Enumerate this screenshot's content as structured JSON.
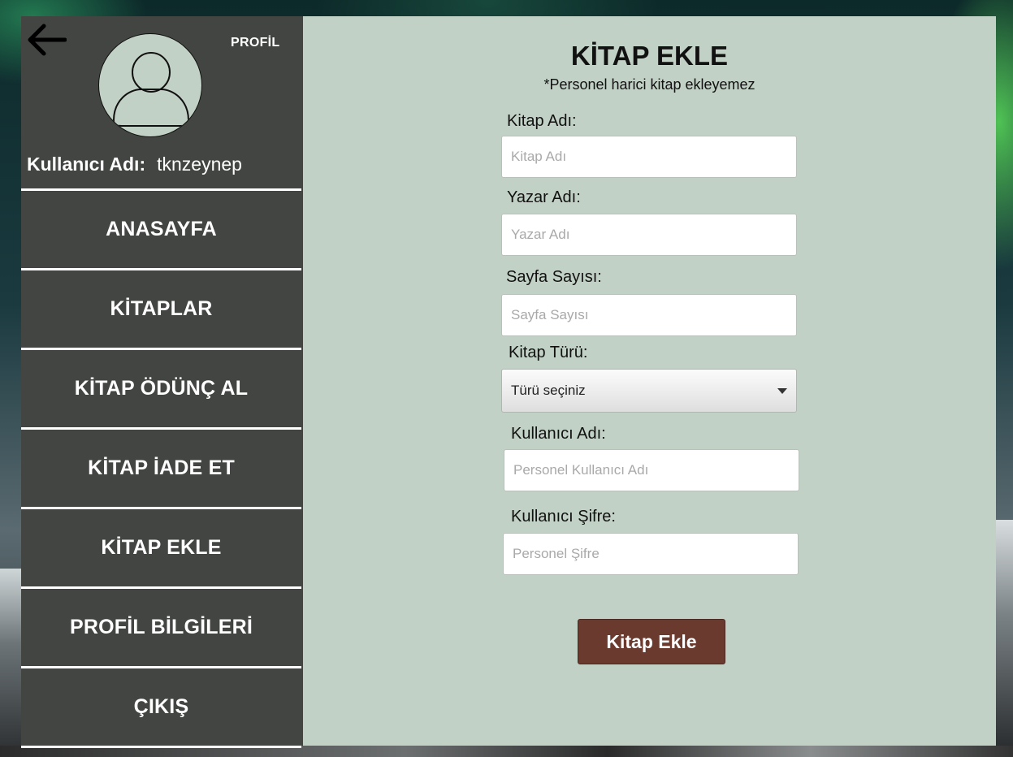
{
  "sidebar": {
    "profile_label": "PROFİL",
    "username_label": "Kullanıcı Adı:",
    "username_value": "tknzeynep",
    "menu": [
      {
        "label": "ANASAYFA"
      },
      {
        "label": "KİTAPLAR"
      },
      {
        "label": "KİTAP ÖDÜNÇ AL"
      },
      {
        "label": "KİTAP İADE ET"
      },
      {
        "label": "KİTAP EKLE"
      },
      {
        "label": "PROFİL BİLGİLERİ"
      },
      {
        "label": "ÇIKIŞ"
      }
    ]
  },
  "form": {
    "title": "KİTAP EKLE",
    "subtitle": "*Personel harici kitap ekleyemez",
    "book_name": {
      "label": "Kitap Adı:",
      "placeholder": "Kitap Adı"
    },
    "author_name": {
      "label": "Yazar Adı:",
      "placeholder": "Yazar Adı"
    },
    "page_count": {
      "label": "Sayfa Sayısı:",
      "placeholder": "Sayfa Sayısı"
    },
    "genre": {
      "label": "Kitap Türü:",
      "selected": "Türü seçiniz"
    },
    "staff_username": {
      "label": "Kullanıcı Adı:",
      "placeholder": "Personel Kullanıcı Adı"
    },
    "staff_password": {
      "label": "Kullanıcı Şifre:",
      "placeholder": "Personel Şifre"
    },
    "submit_label": "Kitap Ekle"
  },
  "icons": {
    "back": "arrow-left-icon",
    "avatar": "user-icon",
    "dropdown": "chevron-down-icon"
  },
  "colors": {
    "sidebar_bg": "#424541",
    "main_bg": "#c2d1c5",
    "button_bg": "#6b3a2e"
  }
}
